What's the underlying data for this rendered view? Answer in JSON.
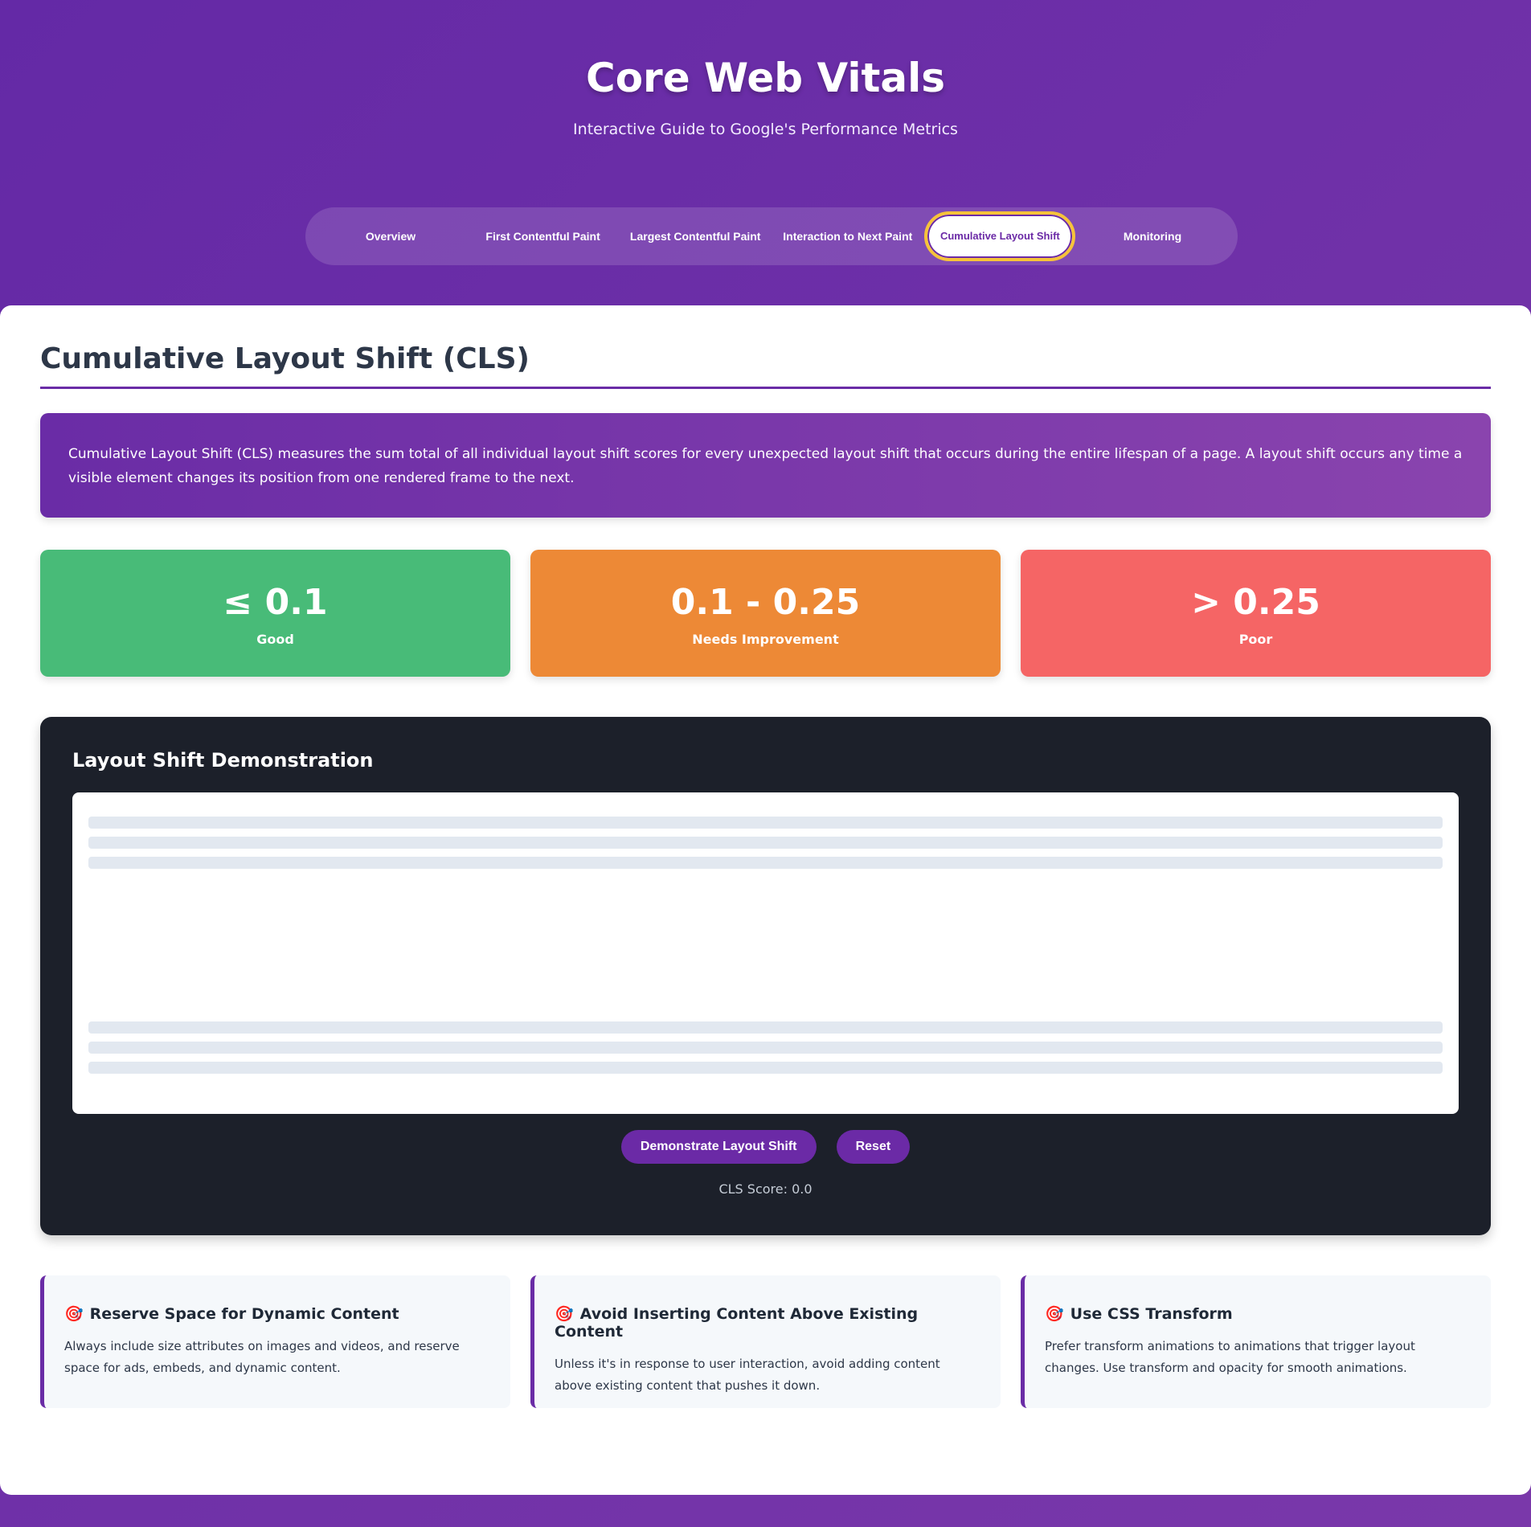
{
  "header": {
    "title": "Core Web Vitals",
    "subtitle": "Interactive Guide to Google's Performance Metrics"
  },
  "nav": {
    "tabs": [
      {
        "label": "Overview"
      },
      {
        "label": "First Contentful Paint"
      },
      {
        "label": "Largest Contentful Paint"
      },
      {
        "label": "Interaction to Next Paint"
      },
      {
        "label": "Cumulative Layout Shift"
      },
      {
        "label": "Monitoring"
      }
    ],
    "active": "Cumulative Layout Shift"
  },
  "section": {
    "title": "Cumulative Layout Shift (CLS)",
    "intro": "Cumulative Layout Shift (CLS) measures the sum total of all individual layout shift scores for every unexpected layout shift that occurs during the entire lifespan of a page. A layout shift occurs any time a visible element changes its position from one rendered frame to the next."
  },
  "thresholds": [
    {
      "value": "≤ 0.1",
      "label": "Good",
      "color": "#48bb78"
    },
    {
      "value": "0.1 - 0.25",
      "label": "Needs Improvement",
      "color": "#ed8936"
    },
    {
      "value": "> 0.25",
      "label": "Poor",
      "color": "#f56565"
    }
  ],
  "demo": {
    "title": "Layout Shift Demonstration",
    "demonstrate_label": "Demonstrate Layout Shift",
    "reset_label": "Reset",
    "score": "CLS Score: 0.0"
  },
  "tips": [
    {
      "icon": "🎯",
      "title": "Reserve Space for Dynamic Content",
      "text": "Always include size attributes on images and videos, and reserve space for ads, embeds, and dynamic content."
    },
    {
      "icon": "🎯",
      "title": "Avoid Inserting Content Above Existing Content",
      "text": "Unless it's in response to user interaction, avoid adding content above existing content that pushes it down."
    },
    {
      "icon": "🎯",
      "title": "Use CSS Transform",
      "text": "Prefer transform animations to animations that trigger layout changes. Use transform and opacity for smooth animations."
    }
  ],
  "colors": {
    "accent": "#6b2aa6",
    "highlight": "#f6c33a",
    "demo_bg": "#1c202a"
  }
}
